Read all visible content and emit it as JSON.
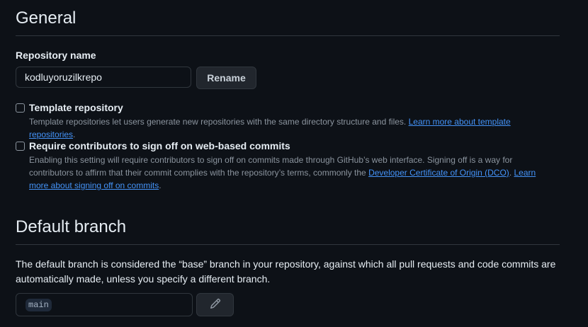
{
  "general": {
    "title": "General",
    "repo_name_label": "Repository name",
    "repo_name_value": "kodluyoruzilkrepo",
    "rename_label": "Rename"
  },
  "template_option": {
    "title": "Template repository",
    "description": "Template repositories let users generate new repositories with the same directory structure and files.",
    "link_text": "Learn more about template repositories",
    "trailing": ".",
    "checked": false
  },
  "signoff_option": {
    "title": "Require contributors to sign off on web-based commits",
    "description": "Enabling this setting will require contributors to sign off on commits made through GitHub’s web interface. Signing off is a way for contributors to affirm that their commit complies with the repository’s terms, commonly the",
    "dco_link": "Developer Certificate of Origin (DCO)",
    "separator": ".",
    "learn_link": "Learn more about signing off on commits",
    "trailing": ".",
    "checked": false
  },
  "default_branch": {
    "title": "Default branch",
    "description": "The default branch is considered the “base” branch in your repository, against which all pull requests and code commits are automatically made, unless you specify a different branch.",
    "branch_name": "main",
    "edit_icon": "pencil-icon"
  },
  "colors": {
    "background": "#0d1117",
    "border": "#30363d",
    "link": "#4493f8",
    "muted_text": "#8b949e"
  }
}
